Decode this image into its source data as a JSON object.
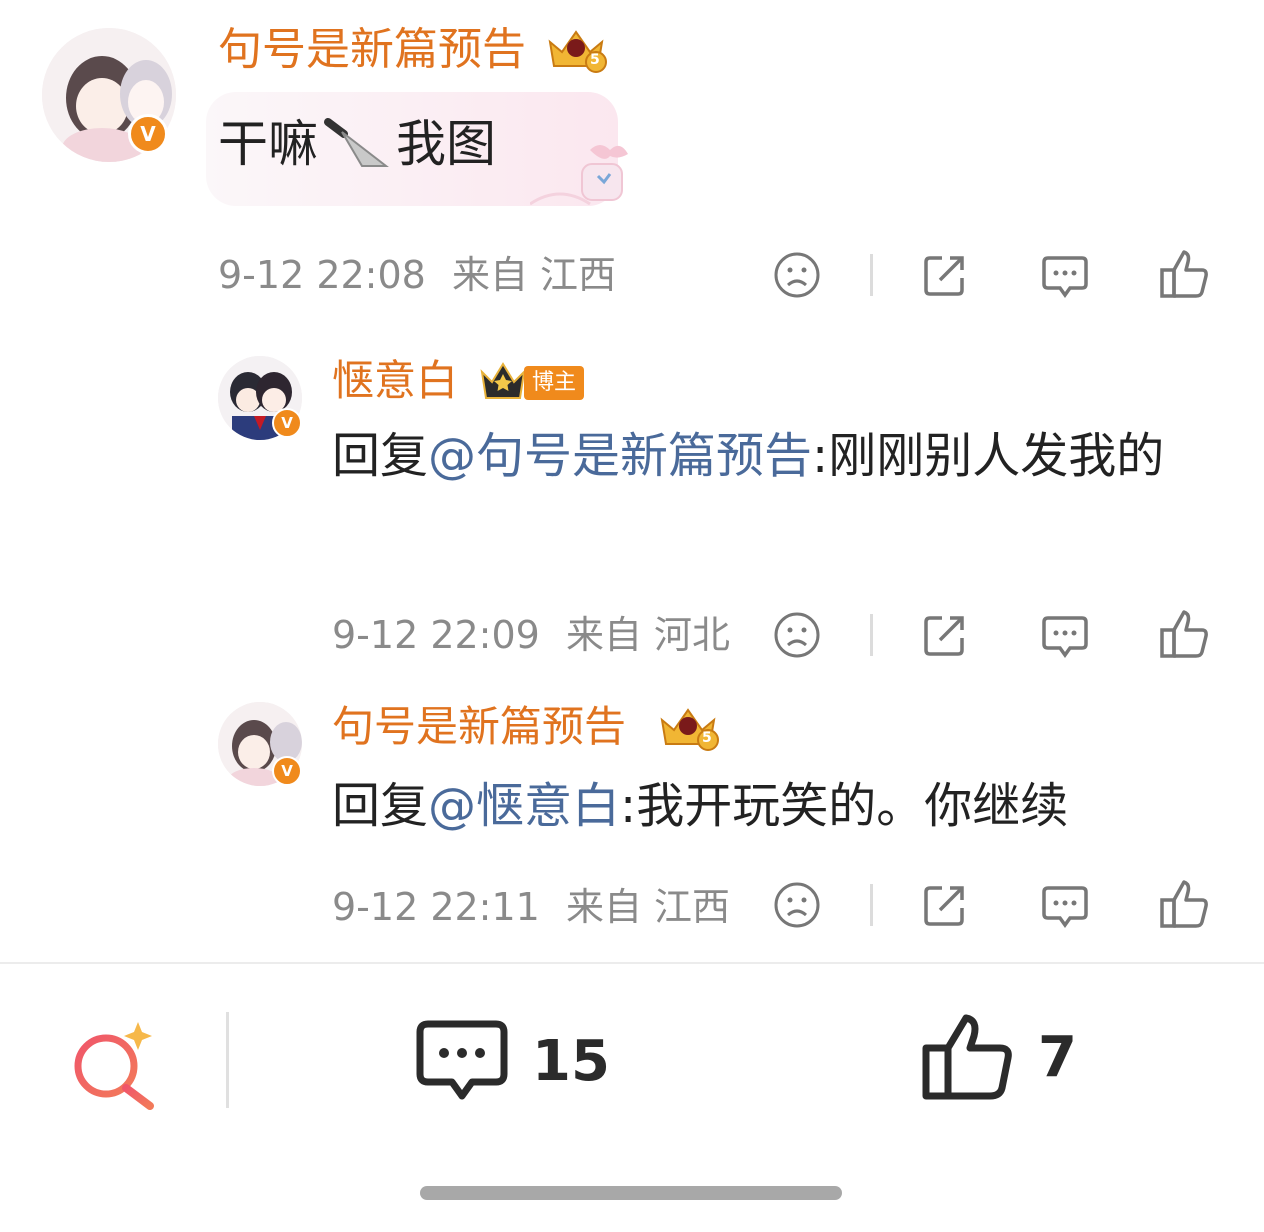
{
  "comment": {
    "username": "句号是新篇预告",
    "text": "干嘛",
    "text_after": "我图",
    "time": "9-12 22:08",
    "location": "来自 江西",
    "level_badge": "5"
  },
  "replies": [
    {
      "username": "惬意白",
      "badge": "博主",
      "prefix": "回复",
      "mention": "@句号是新篇预告",
      "text": ":刚刚别人发我的",
      "time": "9-12 22:09",
      "location": "来自 河北"
    },
    {
      "username": "句号是新篇预告",
      "level_badge": "5",
      "prefix": "回复",
      "mention": "@惬意白",
      "text": ":我开玩笑的。你继续",
      "time": "9-12 22:11",
      "location": "来自 江西"
    }
  ],
  "bottom_bar": {
    "comment_count": "15",
    "like_count": "7"
  },
  "icons": {
    "dislike": "sad-face-icon",
    "share": "share-icon",
    "reply": "comment-bubble-icon",
    "like": "thumbs-up-icon",
    "search": "ai-search-icon",
    "verified": "verified-v-icon",
    "crown": "crown-icon"
  },
  "colors": {
    "username": "#e0731f",
    "mention": "#4a6a9a",
    "meta": "#8a8a8a",
    "verified": "#f08a1c"
  }
}
